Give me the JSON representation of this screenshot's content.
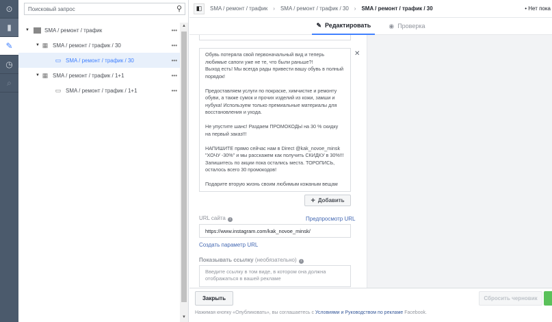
{
  "rail": {
    "icons": [
      "collapse-icon",
      "chart-icon",
      "pencil-icon",
      "clock-icon",
      "search-chart-icon"
    ]
  },
  "tree": {
    "search_placeholder": "Поисковый запрос",
    "items": [
      {
        "label": "SMA / ремонт / трафик",
        "level": 0,
        "icon": "campaign-icon"
      },
      {
        "label": "SMA / ремонт / трафик / 30",
        "level": 1,
        "icon": "adset-icon"
      },
      {
        "label": "SMA / ремонт / трафик / 30",
        "level": 2,
        "icon": "ad-icon",
        "selected": true
      },
      {
        "label": "SMA / ремонт / трафик / 1+1",
        "level": 1,
        "icon": "adset-icon"
      },
      {
        "label": "SMA / ремонт / трафик / 1+1",
        "level": 2,
        "icon": "ad-icon"
      }
    ],
    "more": "•••"
  },
  "header": {
    "crumbs": [
      "SMA / ремонт / трафик",
      "SMA / ремонт / трафик / 30"
    ],
    "current": "SMA / ремонт / трафик / 30",
    "status": "Нет пока"
  },
  "tabs": [
    {
      "label": "Редактировать",
      "icon": "pencil-icon"
    },
    {
      "label": "Проверка",
      "icon": "eye-icon"
    }
  ],
  "form": {
    "primary_text": "Обувь потеряла свой первоначальный вид и теперь любимые сапоги уже не те, что были раньше?!\nВыход есть! Мы всегда рады привести вашу обувь в полный порядок!\n\nПредоставляем услуги по покраске, химчистке и ремонту обуви, а также сумок и прочих изделий из кожи, замши и нубука! Используем только премиальные материалы для восстановления и ухода.\n\nНе упустите шанс! Раздаем ПРОМОКОДЫ на 30 % скидку на первый заказ!!!\n\nНАПИШИТЕ прямо сейчас нам в Direct @kak_novoe_minsk \"ХОЧУ -30%\" и мы расскажем как получить СКИДКУ в 30%!!!\nЗапишитесь по акции пока остались места. ТОРОПИСЬ, осталось всего 30 промокодов!\n\nПодарите вторую жизнь своим любимым кожаным вещам",
    "add_label": "Добавить",
    "url_label": "URL сайта",
    "preview_url": "Предпросмотр URL",
    "url_value": "https://www.instagram.com/kak_novoe_minsk/",
    "create_param": "Создать параметр URL",
    "display_link_label": "Показывать ссылку",
    "display_link_optional": "(необязательно)",
    "display_link_placeholder": "Введите ссылку в том виде, в котором она должна отображаться в вашей рекламе"
  },
  "footer": {
    "close": "Закрыть",
    "reset": "Сбросить черновик",
    "legal_pre": "Нажимая кнопку «Опубликовать», вы соглашаетесь с ",
    "legal_link": "Условиями и Руководством по рекламе",
    "legal_post": " Facebook."
  }
}
